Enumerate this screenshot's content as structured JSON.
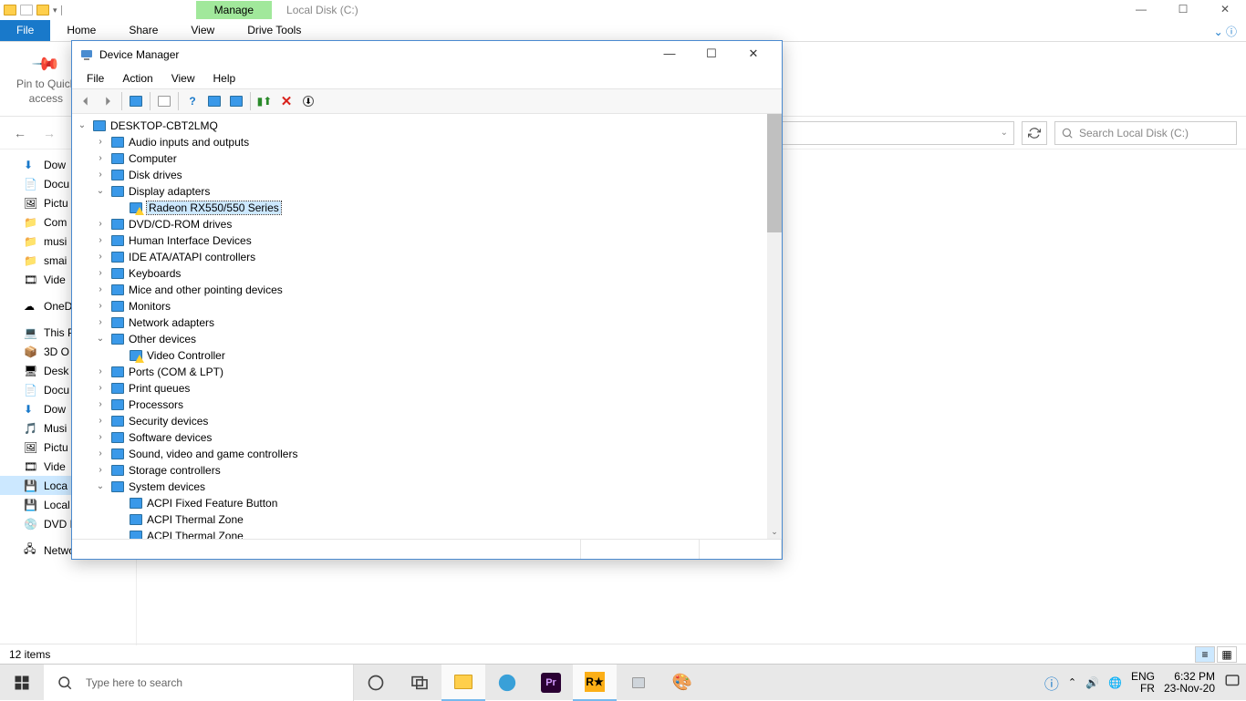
{
  "explorer": {
    "manage_label": "Manage",
    "title": "Local Disk (C:)",
    "tabs": {
      "file": "File",
      "home": "Home",
      "share": "Share",
      "view": "View",
      "drive": "Drive Tools"
    },
    "pin_label1": "Pin to Quick",
    "pin_label2": "access",
    "search_placeholder": "Search Local Disk (C:)",
    "status": "12 items",
    "nav": [
      {
        "label": "Dow",
        "icon": "down"
      },
      {
        "label": "Docu",
        "icon": "doc"
      },
      {
        "label": "Pictu",
        "icon": "pic"
      },
      {
        "label": "Com",
        "icon": "folder"
      },
      {
        "label": "musi",
        "icon": "folder"
      },
      {
        "label": "smai",
        "icon": "folder"
      },
      {
        "label": "Vide",
        "icon": "vid"
      },
      {
        "label": "OneDr",
        "icon": "cloud"
      },
      {
        "label": "This P",
        "icon": "pc"
      },
      {
        "label": "3D O",
        "icon": "3d"
      },
      {
        "label": "Desk",
        "icon": "desk"
      },
      {
        "label": "Docu",
        "icon": "doc"
      },
      {
        "label": "Dow",
        "icon": "down"
      },
      {
        "label": "Musi",
        "icon": "music"
      },
      {
        "label": "Pictu",
        "icon": "pic"
      },
      {
        "label": "Vide",
        "icon": "vid"
      },
      {
        "label": "Loca",
        "icon": "disk",
        "sel": true
      },
      {
        "label": "Local Disk (D:)",
        "icon": "disk"
      },
      {
        "label": "DVD Drive (F:) G",
        "icon": "dvd"
      },
      {
        "label": "Network",
        "icon": "net"
      }
    ]
  },
  "dm": {
    "title": "Device Manager",
    "menus": [
      "File",
      "Action",
      "View",
      "Help"
    ],
    "root": "DESKTOP-CBT2LMQ",
    "tree": [
      {
        "label": "Audio inputs and outputs",
        "lvl": 1,
        "exp": ">"
      },
      {
        "label": "Computer",
        "lvl": 1,
        "exp": ">"
      },
      {
        "label": "Disk drives",
        "lvl": 1,
        "exp": ">"
      },
      {
        "label": "Display adapters",
        "lvl": 1,
        "exp": "v"
      },
      {
        "label": "Radeon RX550/550 Series",
        "lvl": 2,
        "sel": true,
        "warn": true
      },
      {
        "label": "DVD/CD-ROM drives",
        "lvl": 1,
        "exp": ">"
      },
      {
        "label": "Human Interface Devices",
        "lvl": 1,
        "exp": ">"
      },
      {
        "label": "IDE ATA/ATAPI controllers",
        "lvl": 1,
        "exp": ">"
      },
      {
        "label": "Keyboards",
        "lvl": 1,
        "exp": ">"
      },
      {
        "label": "Mice and other pointing devices",
        "lvl": 1,
        "exp": ">"
      },
      {
        "label": "Monitors",
        "lvl": 1,
        "exp": ">"
      },
      {
        "label": "Network adapters",
        "lvl": 1,
        "exp": ">"
      },
      {
        "label": "Other devices",
        "lvl": 1,
        "exp": "v"
      },
      {
        "label": "Video Controller",
        "lvl": 2,
        "warn": true
      },
      {
        "label": "Ports (COM & LPT)",
        "lvl": 1,
        "exp": ">"
      },
      {
        "label": "Print queues",
        "lvl": 1,
        "exp": ">"
      },
      {
        "label": "Processors",
        "lvl": 1,
        "exp": ">"
      },
      {
        "label": "Security devices",
        "lvl": 1,
        "exp": ">"
      },
      {
        "label": "Software devices",
        "lvl": 1,
        "exp": ">"
      },
      {
        "label": "Sound, video and game controllers",
        "lvl": 1,
        "exp": ">"
      },
      {
        "label": "Storage controllers",
        "lvl": 1,
        "exp": ">"
      },
      {
        "label": "System devices",
        "lvl": 1,
        "exp": "v"
      },
      {
        "label": "ACPI Fixed Feature Button",
        "lvl": 2
      },
      {
        "label": "ACPI Thermal Zone",
        "lvl": 2
      },
      {
        "label": "ACPI Thermal Zone",
        "lvl": 2
      }
    ]
  },
  "taskbar": {
    "search": "Type here to search",
    "lang1": "ENG",
    "lang2": "FR",
    "time": "6:32 PM",
    "date": "23-Nov-20"
  }
}
